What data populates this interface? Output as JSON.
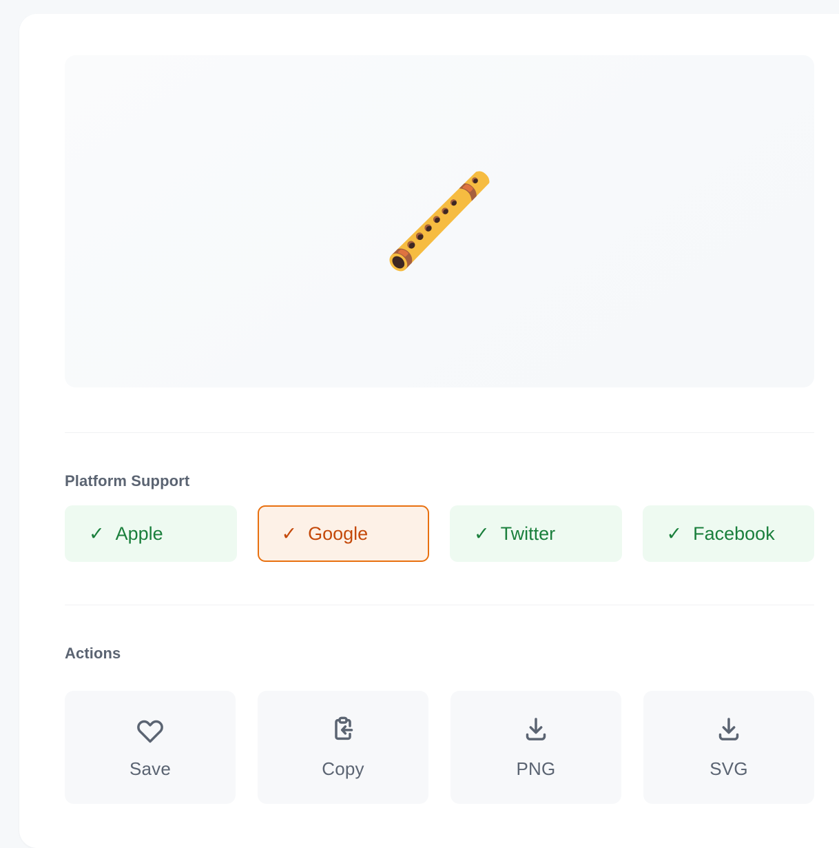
{
  "card": {
    "preview": {
      "emoji_glyph": "🪈",
      "emoji_name": "flute",
      "background_color": "#f8fafc"
    },
    "platform_section": {
      "heading": "Platform Support",
      "items": [
        {
          "label": "Apple",
          "check_icon": "✓",
          "supported": true,
          "state": "supported",
          "bg": "#eefaf1",
          "fg": "#1a7f3c"
        },
        {
          "label": "Google",
          "check_icon": "✓",
          "supported": true,
          "state": "highlight",
          "bg": "#fdf1e7",
          "fg": "#c4490a",
          "border": "#e8700f"
        },
        {
          "label": "Twitter",
          "check_icon": "✓",
          "supported": true,
          "state": "supported",
          "bg": "#eefaf1",
          "fg": "#1a7f3c"
        },
        {
          "label": "Facebook",
          "check_icon": "✓",
          "supported": true,
          "state": "supported",
          "bg": "#eefaf1",
          "fg": "#1a7f3c"
        }
      ]
    },
    "actions_section": {
      "heading": "Actions",
      "items": [
        {
          "label": "Save",
          "icon": "heart-icon"
        },
        {
          "label": "Copy",
          "icon": "clipboard-paste-icon"
        },
        {
          "label": "PNG",
          "icon": "download-icon"
        },
        {
          "label": "SVG",
          "icon": "download-icon"
        }
      ]
    }
  }
}
